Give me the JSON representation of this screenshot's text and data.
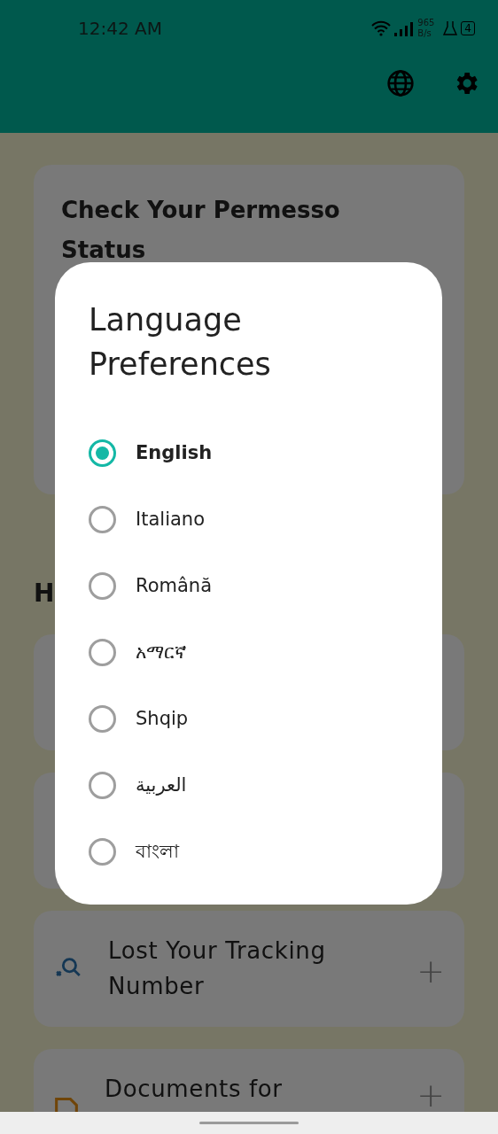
{
  "status_bar": {
    "time": "12:42 AM",
    "speed_value": "965",
    "speed_unit": "B/s",
    "battery": "4"
  },
  "background": {
    "status_card_title": "Check Your Permesso",
    "status_card_title_line2": "Status",
    "section_heading": "H",
    "cards": [
      {
        "kind": "empty"
      },
      {
        "kind": "empty"
      },
      {
        "kind": "search",
        "title": "Lost Your Tracking Number",
        "symbol": "+"
      },
      {
        "kind": "document",
        "title": "Documents for",
        "symbol": "+"
      }
    ]
  },
  "dialog": {
    "title": "Language Preferences",
    "options": [
      {
        "label": "English",
        "selected": true
      },
      {
        "label": "Italiano",
        "selected": false
      },
      {
        "label": "Română",
        "selected": false
      },
      {
        "label": "አማርኛ",
        "selected": false
      },
      {
        "label": "Shqip",
        "selected": false
      },
      {
        "label": "العربية",
        "selected": false
      },
      {
        "label": "বাংলা",
        "selected": false
      }
    ]
  }
}
